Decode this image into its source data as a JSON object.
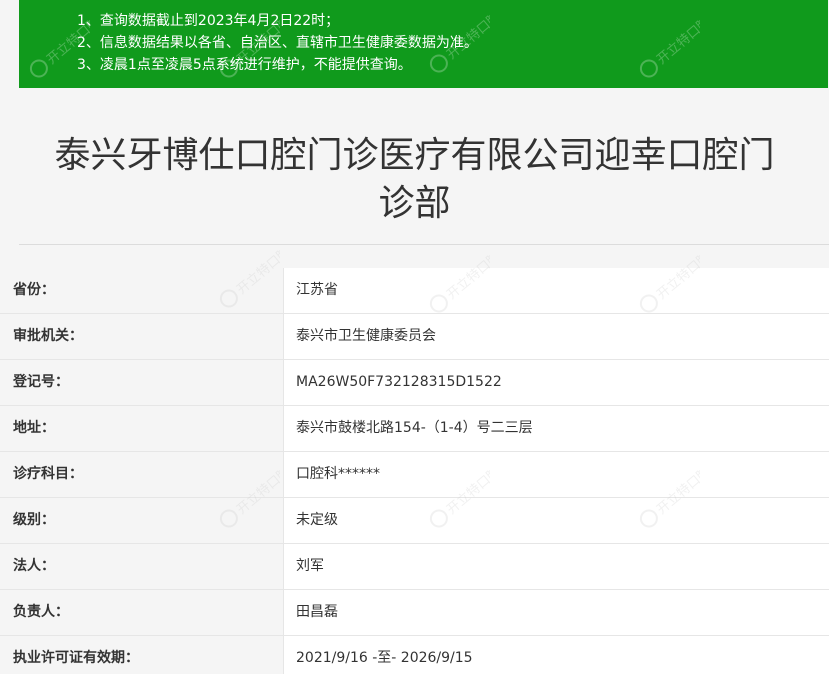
{
  "notice": {
    "lines": [
      "1、查询数据截止到2023年4月2日22时；",
      "2、信息数据结果以各省、自治区、直辖市卫生健康委数据为准。",
      "3、凌晨1点至凌晨5点系统进行维护，不能提供查询。"
    ]
  },
  "clinic": {
    "title": "泰兴牙博仕口腔门诊医疗有限公司迎幸口腔门诊部"
  },
  "details": [
    {
      "label": "省份：",
      "value": "江苏省"
    },
    {
      "label": "审批机关：",
      "value": "泰兴市卫生健康委员会"
    },
    {
      "label": "登记号：",
      "value": "MA26W50F732128315D1522"
    },
    {
      "label": "地址：",
      "value": "泰兴市鼓楼北路154-（1-4）号二三层"
    },
    {
      "label": "诊疗科目：",
      "value": "口腔科******"
    },
    {
      "label": "级别：",
      "value": "未定级"
    },
    {
      "label": "法人：",
      "value": "刘军"
    },
    {
      "label": "负责人：",
      "value": "田昌磊"
    },
    {
      "label": "执业许可证有效期：",
      "value": "2021/9/16 -至- 2026/9/15"
    }
  ],
  "watermark": {
    "text": "开立特口腔",
    "icon": "tooth-logo-icon"
  }
}
